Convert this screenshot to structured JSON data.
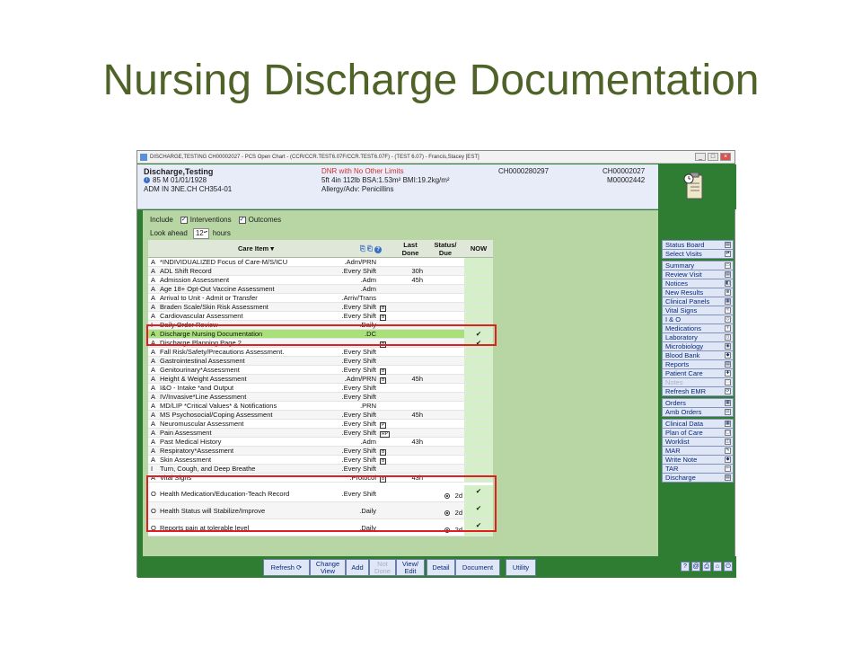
{
  "slide_title": "Nursing Discharge Documentation",
  "window": {
    "title": "DISCHARGE,TESTING CH00002027 - PCS Open Chart - (CCR/CCR.TEST6.07F/CCR.TEST6.07F) - (TEST 6.07) - Francis,Stacey [EST]",
    "controls": [
      "_",
      "□",
      "×"
    ]
  },
  "patient": {
    "name": "Discharge,Testing",
    "line2": "85  M  01/01/1928",
    "line3": "ADM IN  3NE.CH  CH354-01",
    "code_status": "DNR with No Other Limits",
    "height_weight": "5ft 4in  112lb  BSA:1.53m²  BMI:19.2kg/m²",
    "allergy": "Allergy/Adv: Penicillins",
    "account": "CH0000280297",
    "unit_number": "CH00002027",
    "med_record": "M00002442"
  },
  "options": {
    "include_label": "Include",
    "interventions_label": "Interventions",
    "outcomes_label": "Outcomes",
    "look_ahead_label": "Look ahead",
    "look_ahead_value": "12",
    "hours_label": "hours",
    "check": "✓"
  },
  "grid": {
    "headers": {
      "care_item": "Care Item ▾",
      "last_done": "Last\nDone",
      "status_due": "Status/\nDue",
      "now": "NOW"
    },
    "rows": [
      {
        "type": "A",
        "item": "*INDIVIDUALIZED Focus of Care-M/S/ICU",
        "freq": ".Adm/PRN",
        "icon": "",
        "last": "",
        "due": "",
        "now": ""
      },
      {
        "type": "A",
        "item": "ADL Shift Record",
        "freq": ".Every Shift",
        "icon": "",
        "last": "30h",
        "due": "",
        "now": ""
      },
      {
        "type": "A",
        "item": "Admission Assessment",
        "freq": ".Adm",
        "icon": "",
        "last": "45h",
        "due": "",
        "now": ""
      },
      {
        "type": "A",
        "item": "Age 18+ Opt-Out Vaccine Assessment",
        "freq": ".Adm",
        "icon": "",
        "last": "",
        "due": "",
        "now": ""
      },
      {
        "type": "A",
        "item": "Arrival to Unit - Admit or Transfer",
        "freq": ".Arriv/Trans",
        "icon": "",
        "last": "",
        "due": "",
        "now": ""
      },
      {
        "type": "A",
        "item": "Braden Scale/Skin Risk Assessment",
        "freq": ".Every Shift",
        "icon": "B",
        "last": "",
        "due": "",
        "now": ""
      },
      {
        "type": "A",
        "item": "Cardiovascular Assessment",
        "freq": ".Every Shift",
        "icon": "B",
        "last": "",
        "due": "",
        "now": ""
      },
      {
        "type": "I",
        "item": "Daily Order Review",
        "freq": ".Daily",
        "icon": "",
        "last": "",
        "due": "",
        "now": ""
      },
      {
        "type": "A",
        "item": "Discharge Nursing Documentation",
        "freq": ".DC",
        "icon": "",
        "last": "",
        "due": "",
        "now": "✔",
        "highlight": true
      },
      {
        "type": "A",
        "item": "Discharge Planning Page 2",
        "freq": "",
        "icon": "B",
        "last": "",
        "due": "",
        "now": "✔"
      },
      {
        "type": "A",
        "item": "Fall Risk/Safety/Precautions Assessment.",
        "freq": ".Every Shift",
        "icon": "",
        "last": "",
        "due": "",
        "now": ""
      },
      {
        "type": "A",
        "item": "Gastrointestinal Assessment",
        "freq": ".Every Shift",
        "icon": "",
        "last": "",
        "due": "",
        "now": ""
      },
      {
        "type": "A",
        "item": "Genitourinary*Assessment",
        "freq": ".Every Shift",
        "icon": "B",
        "last": "",
        "due": "",
        "now": ""
      },
      {
        "type": "A",
        "item": "Height & Weight Assessment",
        "freq": ".Adm/PRN",
        "icon": "B",
        "last": "45h",
        "due": "",
        "now": ""
      },
      {
        "type": "A",
        "item": "I&O - Intake *and Output",
        "freq": ".Every Shift",
        "icon": "",
        "last": "",
        "due": "",
        "now": ""
      },
      {
        "type": "A",
        "item": "IV/Invasive*Line Assessment",
        "freq": ".Every Shift",
        "icon": "",
        "last": "",
        "due": "",
        "now": ""
      },
      {
        "type": "A",
        "item": "MD/LIP *Critical Values* & Notifications",
        "freq": ".PRN",
        "icon": "",
        "last": "",
        "due": "",
        "now": ""
      },
      {
        "type": "A",
        "item": "MS Psychosocial/Coping Assessment",
        "freq": ".Every Shift",
        "icon": "",
        "last": "45h",
        "due": "",
        "now": ""
      },
      {
        "type": "A",
        "item": "Neuromuscular Assessment",
        "freq": ".Every Shift",
        "icon": "P",
        "last": "",
        "due": "",
        "now": ""
      },
      {
        "type": "A",
        "item": "Pain Assessment",
        "freq": ".Every Shift",
        "icon": "RP",
        "last": "",
        "due": "",
        "now": ""
      },
      {
        "type": "A",
        "item": "Past Medical History",
        "freq": ".Adm",
        "icon": "",
        "last": "43h",
        "due": "",
        "now": ""
      },
      {
        "type": "A",
        "item": "Respiratory*Assessment",
        "freq": ".Every Shift",
        "icon": "B",
        "last": "",
        "due": "",
        "now": ""
      },
      {
        "type": "A",
        "item": "Skin Assessment",
        "freq": ".Every Shift",
        "icon": "B",
        "last": "",
        "due": "",
        "now": ""
      },
      {
        "type": "I",
        "item": "Turn, Cough, and Deep Breathe",
        "freq": ".Every Shift",
        "icon": "",
        "last": "",
        "due": "",
        "now": ""
      },
      {
        "type": "A",
        "item": "Vital Signs",
        "freq": ".Protocol",
        "icon": "B",
        "last": "43h",
        "due": "",
        "now": ""
      }
    ],
    "outcomes": [
      {
        "type": "O",
        "item": "Health Medication/Education-Teach Record",
        "freq": ".Every Shift",
        "due": "2d",
        "now": "✔"
      },
      {
        "type": "O",
        "item": "Health Status will Stabilize/Improve",
        "freq": ".Daily",
        "due": "2d",
        "now": "✔"
      },
      {
        "type": "O",
        "item": "Reports pain at tolerable level",
        "freq": ".Daily",
        "due": "2d",
        "now": "✔"
      }
    ]
  },
  "nav": [
    {
      "group": [
        "Status Board",
        "Select Visits"
      ]
    },
    {
      "group": [
        "Summary",
        "Review Visit",
        "Notices",
        "New Results",
        "Clinical Panels",
        "Vital Signs",
        "I & O",
        "Medications",
        "Laboratory",
        "Microbiology",
        "Blood Bank",
        "Reports",
        "Patient Care",
        "Notes",
        "Refresh EMR"
      ]
    },
    {
      "group": [
        "Orders",
        "Amb Orders"
      ]
    },
    {
      "group": [
        "Clinical Data",
        "Plan of Care",
        "Worklist",
        "MAR",
        "Write Note",
        "TAR",
        "Discharge"
      ]
    }
  ],
  "toolbar": {
    "refresh": "Refresh ⟳",
    "change_view": "Change View",
    "add": "Add",
    "not_done": "Not Done",
    "view_edit": "View/ Edit",
    "detail": "Detail",
    "document": "Document",
    "utility": "Utility",
    "icons": [
      "?",
      "@",
      "⎙",
      "⌂",
      "⏻"
    ]
  }
}
